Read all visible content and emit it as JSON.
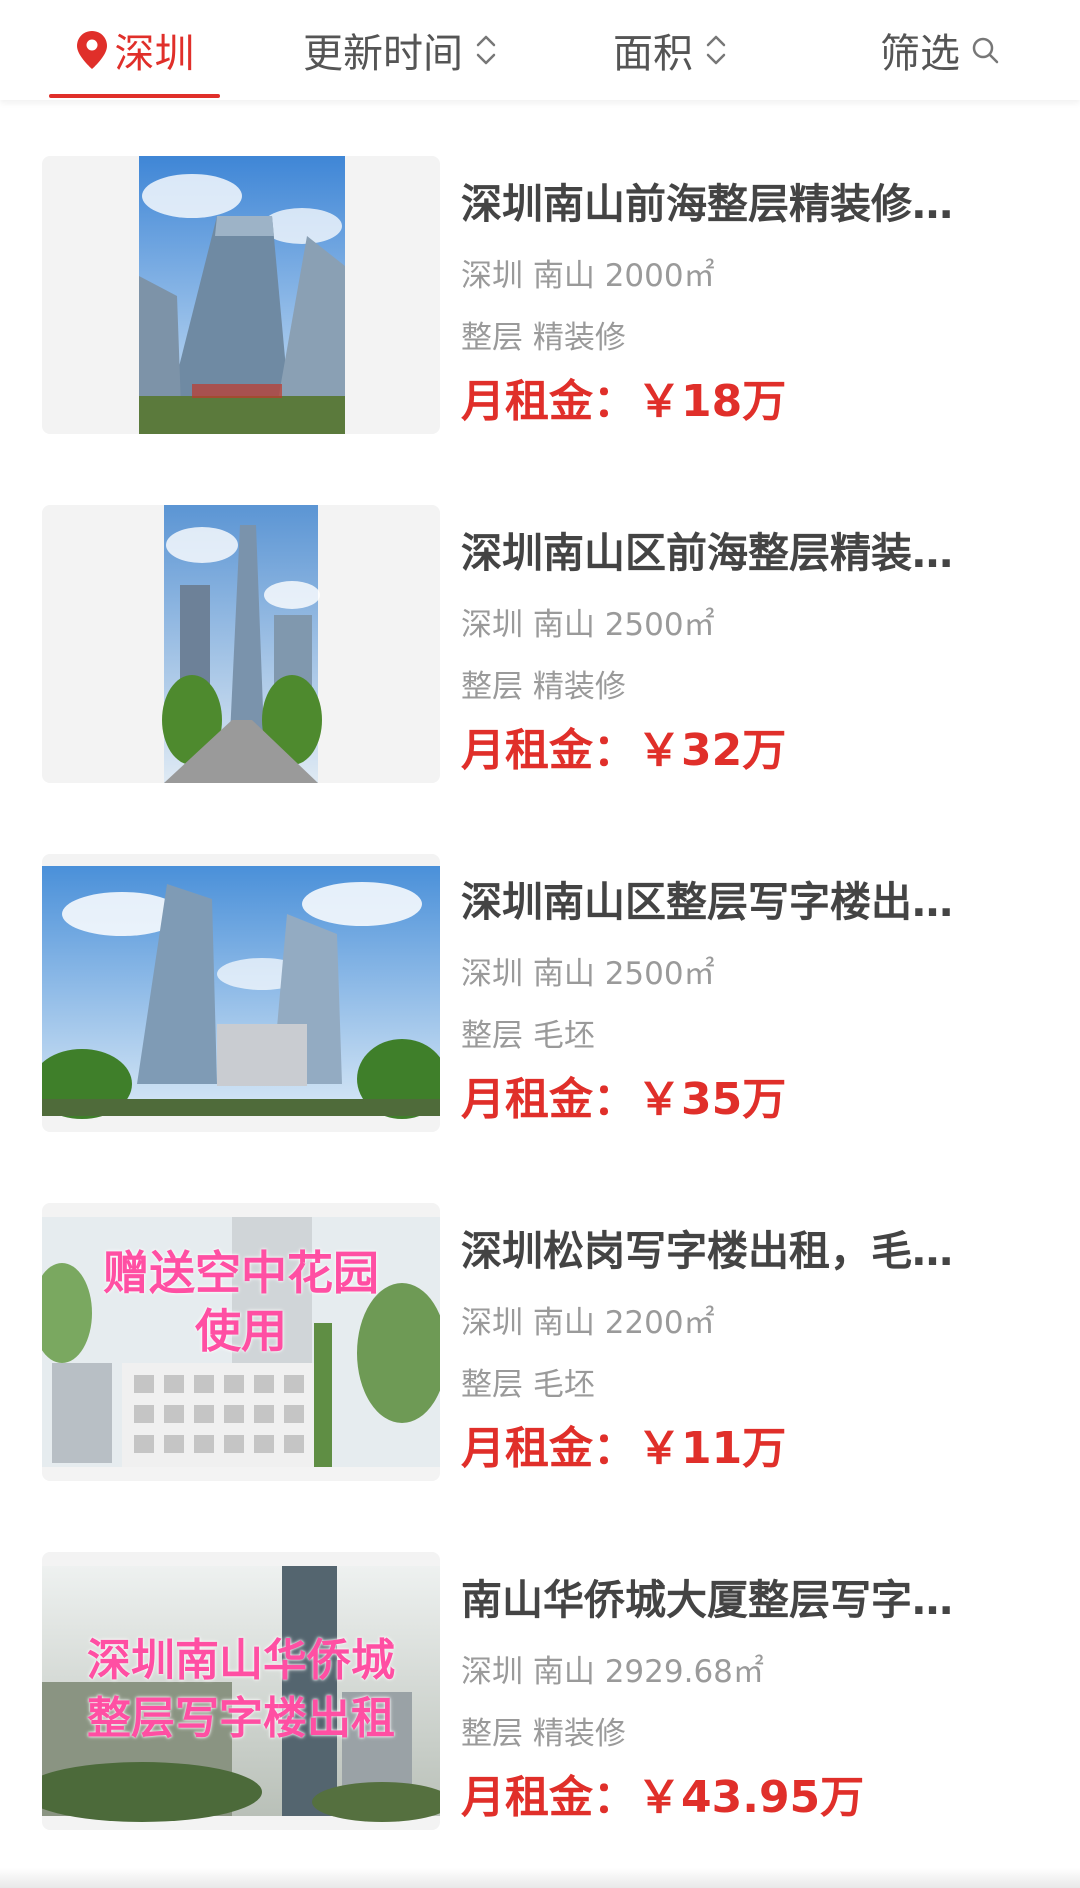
{
  "tabs": {
    "city": {
      "label": "深圳",
      "icon": "location-pin-icon"
    },
    "update_time": {
      "label": "更新时间",
      "icon": "sort-updown-icon"
    },
    "area": {
      "label": "面积",
      "icon": "sort-updown-icon"
    },
    "filter": {
      "label": "筛选",
      "icon": "search-icon"
    }
  },
  "colors": {
    "accent": "#e02f2a",
    "muted": "#9a9a9a",
    "title": "#444444"
  },
  "listings": [
    {
      "title": "深圳南山前海整层精装修…",
      "meta": "深圳 南山 2000㎡",
      "tags": "整层 精装修",
      "price": "月租金：￥18万",
      "image": "office-tower-photo"
    },
    {
      "title": "深圳南山区前海整层精装…",
      "meta": "深圳 南山 2500㎡",
      "tags": "整层 精装修",
      "price": "月租金：￥32万",
      "image": "office-tower-photo"
    },
    {
      "title": "深圳南山区整层写字楼出…",
      "meta": "深圳 南山 2500㎡",
      "tags": "整层 毛坯",
      "price": "月租金：￥35万",
      "image": "twin-towers-photo"
    },
    {
      "title": "深圳松岗写字楼出租，毛…",
      "meta": "深圳 南山 2200㎡",
      "tags": "整层 毛坯",
      "price": "月租金：￥11万",
      "image": "building-photo",
      "overlay": [
        "赠送空中花园",
        "使用"
      ]
    },
    {
      "title": "南山华侨城大厦整层写字…",
      "meta": "深圳 南山 2929.68㎡",
      "tags": "整层 精装修",
      "price": "月租金：￥43.95万",
      "image": "city-skyline-photo",
      "overlay": [
        "深圳南山华侨城",
        "整层写字楼出租"
      ]
    }
  ]
}
